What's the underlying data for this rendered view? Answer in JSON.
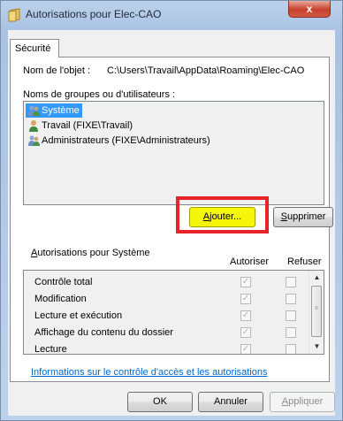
{
  "window": {
    "title": "Autorisations pour Elec-CAO",
    "close_glyph": "x"
  },
  "tabs": [
    {
      "label": "Sécurité"
    }
  ],
  "object": {
    "label": "Nom de l'objet :",
    "path": "C:\\Users\\Travail\\AppData\\Roaming\\Elec-CAO"
  },
  "groups": {
    "label": "Noms de groupes ou d'utilisateurs :",
    "items": [
      {
        "label": "Système"
      },
      {
        "label": "Travail (FIXE\\Travail)"
      },
      {
        "label": "Administrateurs (FIXE\\Administrateurs)"
      }
    ]
  },
  "buttons": {
    "add_rest": "jouter...",
    "remove_rest": "upprimer",
    "ok": "OK",
    "cancel": "Annuler",
    "apply_rest": "ppliquer"
  },
  "permissions": {
    "label_rest": "utorisations pour Système",
    "allow_header": "Autoriser",
    "deny_header": "Refuser",
    "rows": [
      {
        "label": "Contrôle total",
        "allow": true,
        "deny": false
      },
      {
        "label": "Modification",
        "allow": true,
        "deny": false
      },
      {
        "label": "Lecture et exécution",
        "allow": true,
        "deny": false
      },
      {
        "label": "Affichage du contenu du dossier",
        "allow": true,
        "deny": false
      },
      {
        "label": "Lecture",
        "allow": true,
        "deny": false
      }
    ]
  },
  "help_link": "Informations sur le contrôle d'accès et les autorisations",
  "colors": {
    "highlight_button": "#f5f507",
    "annotation_box": "#e8242a",
    "selection": "#3399ff"
  }
}
